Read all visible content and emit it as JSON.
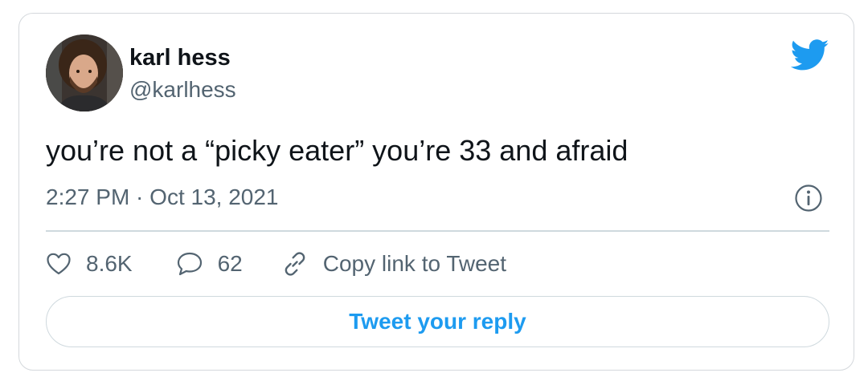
{
  "author": {
    "name": "karl hess",
    "handle": "@karlhess"
  },
  "tweet": {
    "text": "you’re not a “picky eater” you’re 33 and afraid",
    "timestamp": "2:27 PM · Oct 13, 2021"
  },
  "actions": {
    "likes": "8.6K",
    "replies": "62",
    "copy_link": "Copy link to Tweet"
  },
  "reply_button": {
    "label": "Tweet your reply"
  },
  "icons": {
    "brand": "twitter-bird-icon",
    "info": "info-icon",
    "like": "heart-icon",
    "reply": "speech-bubble-icon",
    "copy_link": "link-icon"
  },
  "colors": {
    "brand": "#1d9bf0",
    "text_primary": "#0f1419",
    "text_secondary": "#536471",
    "border": "#cfd9de"
  }
}
